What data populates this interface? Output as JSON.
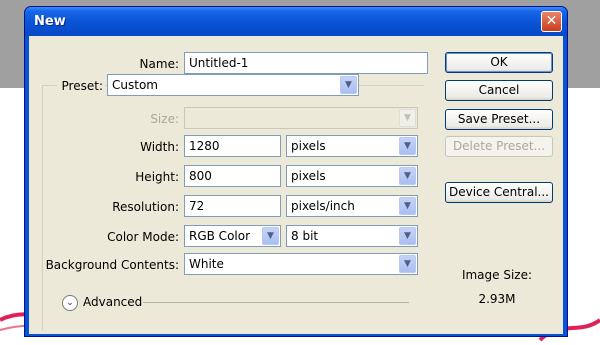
{
  "dialog": {
    "title": "New",
    "close_glyph": "✕"
  },
  "form": {
    "name_label": "Name:",
    "name_value": "Untitled-1",
    "preset_label": "Preset:",
    "preset_value": "Custom",
    "size_label": "Size:",
    "size_value": "",
    "width_label": "Width:",
    "width_value": "1280",
    "width_unit": "pixels",
    "height_label": "Height:",
    "height_value": "800",
    "height_unit": "pixels",
    "resolution_label": "Resolution:",
    "resolution_value": "72",
    "resolution_unit": "pixels/inch",
    "color_mode_label": "Color Mode:",
    "color_mode_value": "RGB Color",
    "bit_depth_value": "8 bit",
    "background_label": "Background Contents:",
    "background_value": "White",
    "advanced_label": "Advanced"
  },
  "buttons": {
    "ok": "OK",
    "cancel": "Cancel",
    "save_preset": "Save Preset...",
    "delete_preset": "Delete Preset...",
    "device_central": "Device Central..."
  },
  "info": {
    "image_size_label": "Image Size:",
    "image_size_value": "2.93M"
  },
  "icons": {
    "dropdown": "chevron-down-icon",
    "advanced_toggle": "double-chevron-down-icon"
  },
  "colors": {
    "title_bar": "#0a53d6",
    "dialog_bg": "#ece9d8",
    "close_button": "#c83c1c"
  }
}
